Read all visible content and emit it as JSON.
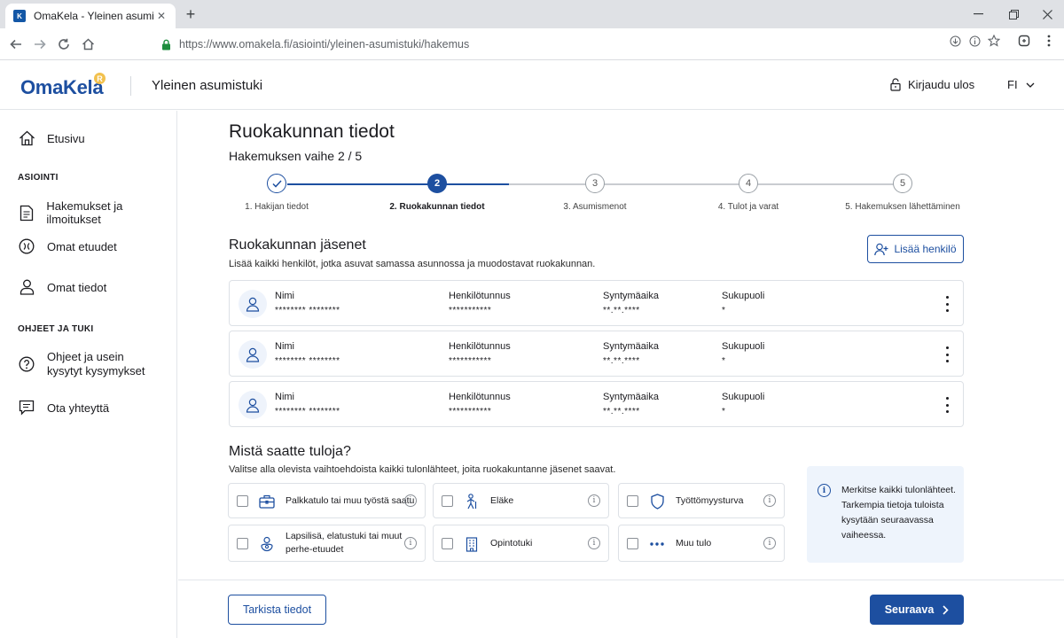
{
  "browser": {
    "tab_title": "OmaKela - Yleinen asumistuki",
    "favicon_text": "K",
    "url_host": "https://www.omakela.fi",
    "url_path": "/asiointi/yleinen-asumistuki/hakemus"
  },
  "header": {
    "logo": "OmaKela",
    "logo_badge": "R",
    "app_title": "Yleinen asumistuki",
    "logout_label": "Kirjaudu ulos",
    "language": "FI"
  },
  "sidebar": {
    "home": "Etusivu",
    "section_asiointi": "ASIOINTI",
    "items": [
      {
        "label": "Hakemukset ja ilmoitukset"
      },
      {
        "label": "Omat etuudet"
      },
      {
        "label": "Omat tiedot"
      }
    ],
    "section_help": "OHJEET JA TUKI",
    "help_items": [
      {
        "label_line1": "Ohjeet ja usein",
        "label_line2": "kysytyt kysymykset"
      },
      {
        "label": "Ota yhteyttä"
      }
    ]
  },
  "main": {
    "title": "Ruokakunnan tiedot",
    "step_text": "Hakemuksen vaihe 2 / 5",
    "stepper": [
      {
        "number": "✓",
        "label": "1. Hakijan tiedot",
        "state": "done"
      },
      {
        "number": "2",
        "label": "2. Ruokakunnan tiedot",
        "state": "current"
      },
      {
        "number": "3",
        "label": "3. Asumismenot",
        "state": "todo"
      },
      {
        "number": "4",
        "label": "4. Tulot ja varat",
        "state": "todo"
      },
      {
        "number": "5",
        "label": "5. Hakemuksen lähettäminen",
        "state": "todo"
      }
    ],
    "members_title": "Ruokakunnan jäsenet",
    "members_desc": "Lisää kaikki henkilöt, jotka asuvat samassa asunnossa ja muodostavat ruokakunnan.",
    "add_person": "Lisää henkilö",
    "member_headers": {
      "name": "Nimi",
      "ssn": "Henkilötunnus",
      "birthdate": "Syntymäaika",
      "gender": "Sukupuoli"
    },
    "members": [
      {
        "name": "******** ********",
        "ssn": "***********",
        "birthdate": "**.**.****",
        "gender": "*"
      },
      {
        "name": "******** ********",
        "ssn": "***********",
        "birthdate": "**.**.****",
        "gender": "*"
      },
      {
        "name": "******** ********",
        "ssn": "***********",
        "birthdate": "**.**.****",
        "gender": "*"
      }
    ],
    "income_title": "Mistä saatte tuloja?",
    "income_desc": "Valitse alla olevista vaihtoehdoista kaikki tulonlähteet, joita ruokakuntanne jäsenet saavat.",
    "income_options": [
      {
        "label": "Palkkatulo tai muu työstä saatu",
        "icon": "briefcase-icon",
        "checked": false
      },
      {
        "label": "Eläke",
        "icon": "person-cane-icon",
        "checked": false
      },
      {
        "label": "Työttömyysturva",
        "icon": "shield-icon",
        "checked": false
      },
      {
        "label_line1": "Lapsilisä, elatustuki tai muut",
        "label_line2": "perhe-etuudet",
        "icon": "family-icon",
        "checked": false
      },
      {
        "label": "Opintotuki",
        "icon": "building-icon",
        "checked": false
      },
      {
        "label": "Muu tulo",
        "icon": "more-dots-icon",
        "checked": false
      }
    ],
    "info_text": "Merkitse kaikki tulonlähteet. Tarkempia tietoja tuloista kysytään seuraavassa vaiheessa.",
    "info_symbol": "i",
    "back_button": "Tarkista tiedot",
    "next_button": "Seuraava"
  },
  "colors": {
    "brand": "#1d4fa0",
    "info_bg": "#eef4fc",
    "border": "#dde1e6"
  }
}
